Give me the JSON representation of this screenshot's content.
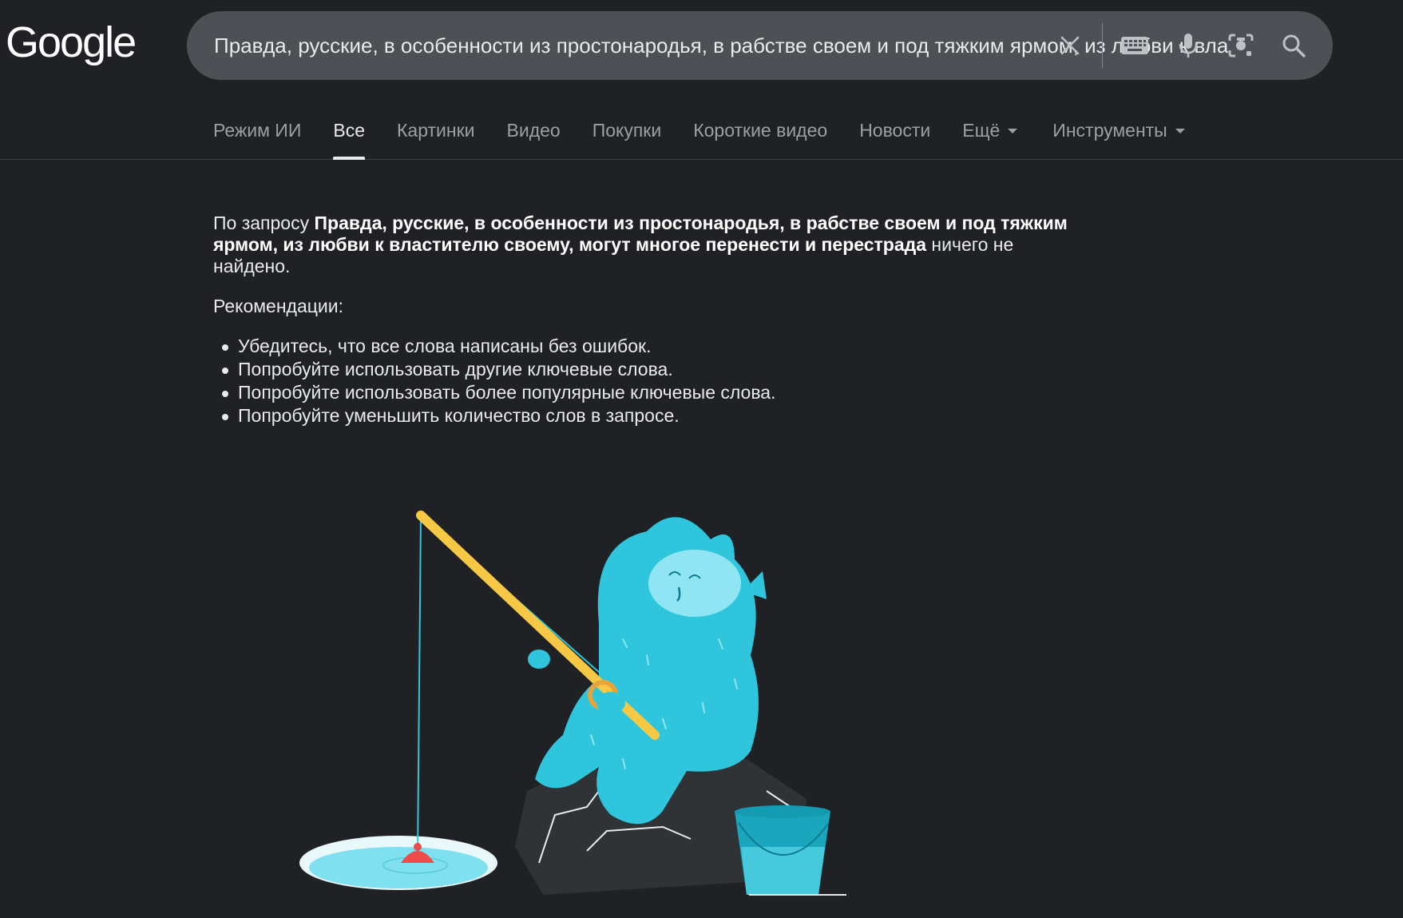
{
  "logo": {
    "text": "Google"
  },
  "search": {
    "query": "Правда, русские, в особенности из простонародья, в рабстве своем и под тяжким ярмом, из любви к властителю своему, могут многое перенести и перестрада",
    "clear_icon": "close-icon",
    "keyboard_icon": "keyboard-icon",
    "voice_icon": "microphone-icon",
    "lens_icon": "camera-lens-icon",
    "search_icon": "search-icon"
  },
  "tabs": [
    {
      "label": "Режим ИИ"
    },
    {
      "label": "Все",
      "active": true
    },
    {
      "label": "Картинки"
    },
    {
      "label": "Видео"
    },
    {
      "label": "Покупки"
    },
    {
      "label": "Короткие видео"
    },
    {
      "label": "Новости"
    },
    {
      "label": "Ещё",
      "dropdown": true
    },
    {
      "label": "Инструменты",
      "dropdown": true
    }
  ],
  "no_results": {
    "prefix": "По запросу ",
    "query": "Правда, русские, в особенности из простонародья, в рабстве своем и под тяжким ярмом, из любви к властителю своему, могут многое перенести и перестрада",
    "suffix": " ничего не найдено.",
    "recommendations_title": "Рекомендации:",
    "recommendations": [
      "Убедитесь, что все слова написаны без ошибок.",
      "Попробуйте использовать другие ключевые слова.",
      "Попробуйте использовать более популярные ключевые слова.",
      "Попробуйте уменьшить количество слов в запросе."
    ]
  },
  "colors": {
    "background": "#202124",
    "search_bg": "#4d5156",
    "text": "#e8eaed",
    "muted": "#9aa0a6",
    "creature": "#2ec5dd",
    "rod": "#f6c844",
    "bobber": "#ee4b4b"
  }
}
